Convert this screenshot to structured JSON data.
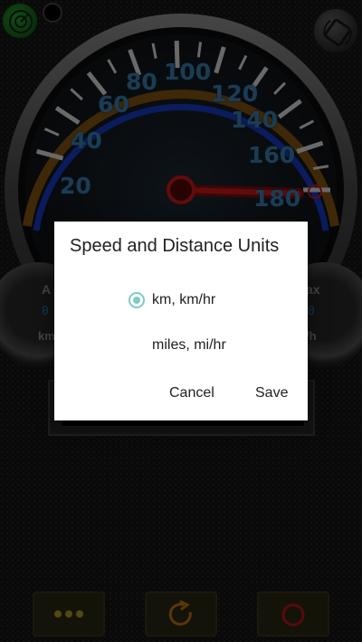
{
  "gauge": {
    "scale_labels": [
      "20",
      "40",
      "60",
      "80",
      "100",
      "120",
      "140",
      "160",
      "180"
    ],
    "needle_value": 180,
    "max_value": 180
  },
  "sub_gauges": {
    "left": {
      "label": "A",
      "unit": "km",
      "digit": "0"
    },
    "right": {
      "label": "ax",
      "unit": "/h",
      "digit": "0"
    }
  },
  "toolbar": {
    "gps_icon": "gps-radar-icon",
    "rotate_icon": "rotate-screen-icon",
    "menu_icon": "more-dots-icon",
    "reset_icon": "refresh-icon",
    "power_icon": "power-icon"
  },
  "dialog": {
    "title": "Speed and Distance Units",
    "options": [
      {
        "label": "km, km/hr",
        "selected": true
      },
      {
        "label": "miles, mi/hr",
        "selected": false
      }
    ],
    "cancel_label": "Cancel",
    "save_label": "Save"
  },
  "colors": {
    "gauge_ring": "#1a3fd1",
    "needle": "#d81b1b",
    "label": "#3f85b8",
    "radio_accent": "#80cbc4",
    "button_yellow": "#b7a21c",
    "reset_orange": "#c47a12",
    "power_red": "#c21818"
  }
}
